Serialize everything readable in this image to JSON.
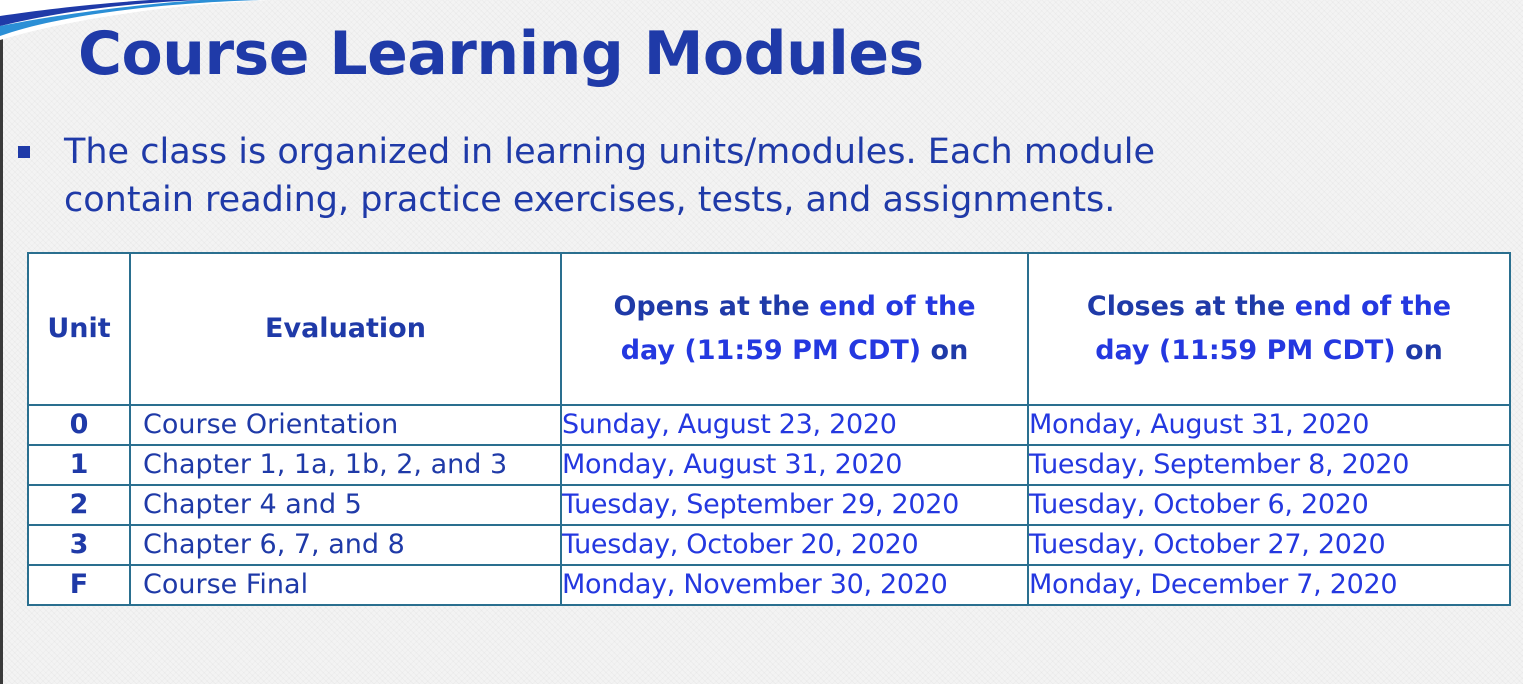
{
  "slide": {
    "title": "Course Learning Modules",
    "bullet_line1": "The class is organized in learning units/modules. Each module",
    "bullet_line2": "contain reading, practice exercises, tests, and assignments."
  },
  "table": {
    "headers": {
      "unit": "Unit",
      "evaluation": "Evaluation",
      "opens": {
        "lead": "Opens at the ",
        "accent": "end of the",
        "line2_accent": "day (11:59 PM CDT)",
        "tail": " on"
      },
      "closes": {
        "lead": "Closes at the ",
        "accent": "end of the",
        "line2_accent": "day (11:59 PM CDT)",
        "tail": " on"
      }
    },
    "rows": [
      {
        "unit": "0",
        "evaluation": "Course Orientation",
        "opens": "Sunday, August 23, 2020",
        "closes": "Monday, August 31, 2020"
      },
      {
        "unit": "1",
        "evaluation": "Chapter 1, 1a, 1b, 2, and 3",
        "opens": "Monday, August 31, 2020",
        "closes": "Tuesday, September 8, 2020"
      },
      {
        "unit": "2",
        "evaluation": "Chapter 4 and 5",
        "opens": "Tuesday, September 29, 2020",
        "closes": "Tuesday, October 6, 2020"
      },
      {
        "unit": "3",
        "evaluation": "Chapter 6, 7, and 8",
        "opens": "Tuesday, October 20, 2020",
        "closes": "Tuesday, October 27, 2020"
      },
      {
        "unit": "F",
        "evaluation": "Course Final",
        "opens": "Monday, November 30, 2020",
        "closes": "Monday, December 7, 2020"
      }
    ]
  },
  "colors": {
    "title_blue": "#1f3aa8",
    "accent_blue": "#2438e0",
    "table_border": "#2a6f8f"
  }
}
